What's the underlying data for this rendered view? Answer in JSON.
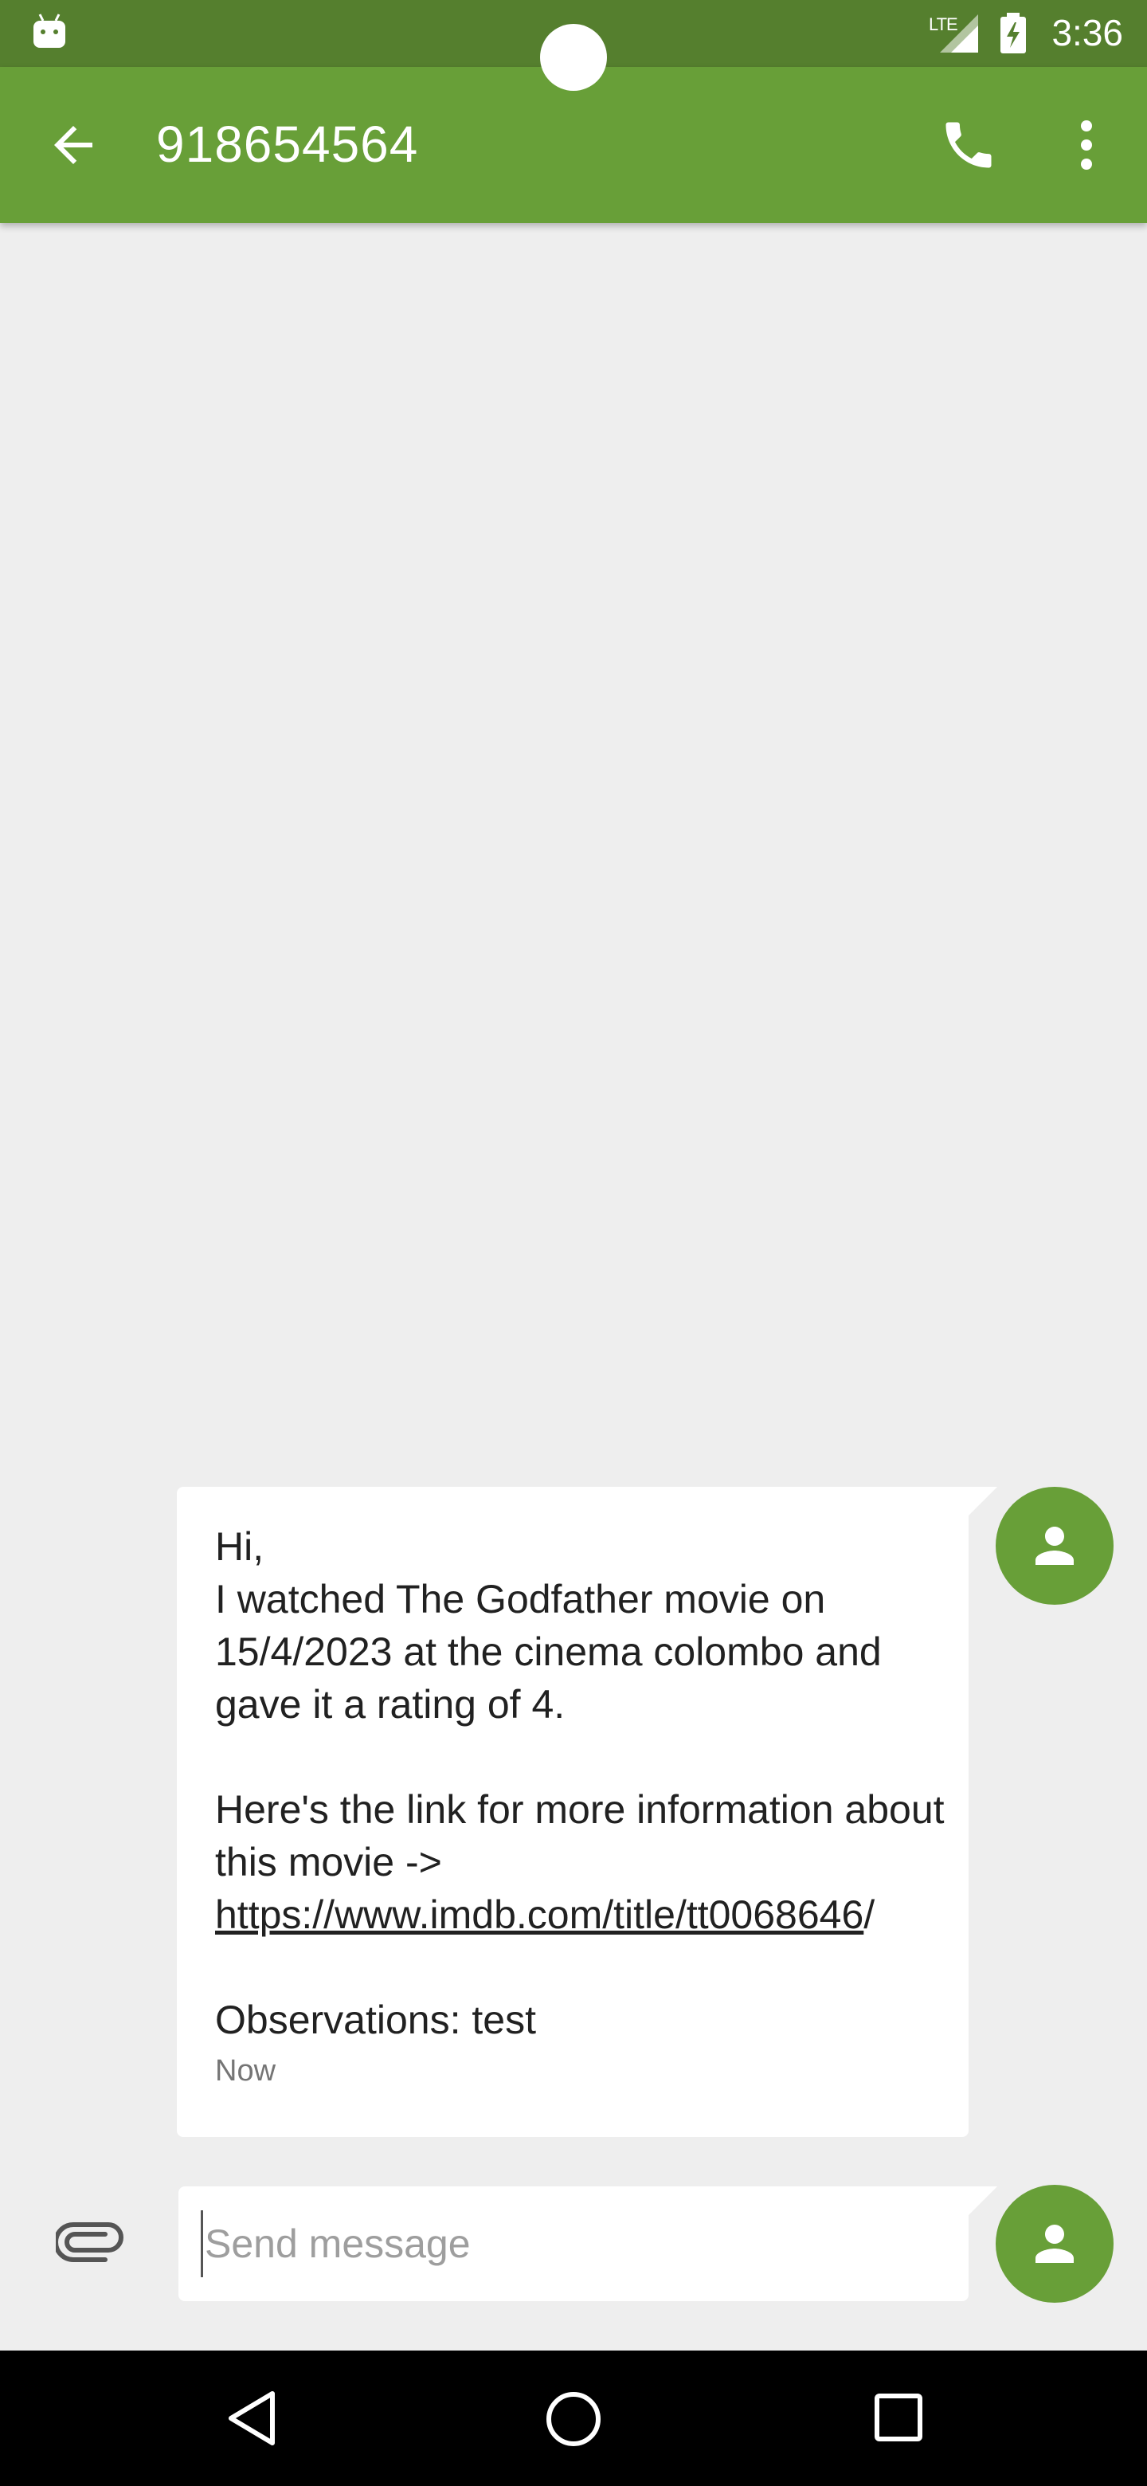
{
  "status_bar": {
    "network_label": "LTE",
    "time": "3:36"
  },
  "header": {
    "title": "918654564"
  },
  "message": {
    "lines_group1": [
      "Hi,",
      "I watched The Godfather movie on 15/4/2023 at the cinema colombo and gave it a rating of 4."
    ],
    "line2_prefix": "Here's the link for more information about this movie -> ",
    "link_text": "https://www.imdb.com/title/tt0068646",
    "link_suffix": "/",
    "observations": "Observations: test",
    "timestamp": "Now"
  },
  "compose": {
    "placeholder": "Send message"
  },
  "colors": {
    "status_bar": "#557f2e",
    "app_bar": "#689f38",
    "background": "#eeeeee",
    "bubble": "#ffffff"
  },
  "icons": [
    "android-icon",
    "signal-icon",
    "battery-icon",
    "back-arrow-icon",
    "phone-icon",
    "more-vert-icon",
    "person-icon",
    "attach-icon",
    "nav-back-icon",
    "nav-home-icon",
    "nav-recents-icon"
  ]
}
